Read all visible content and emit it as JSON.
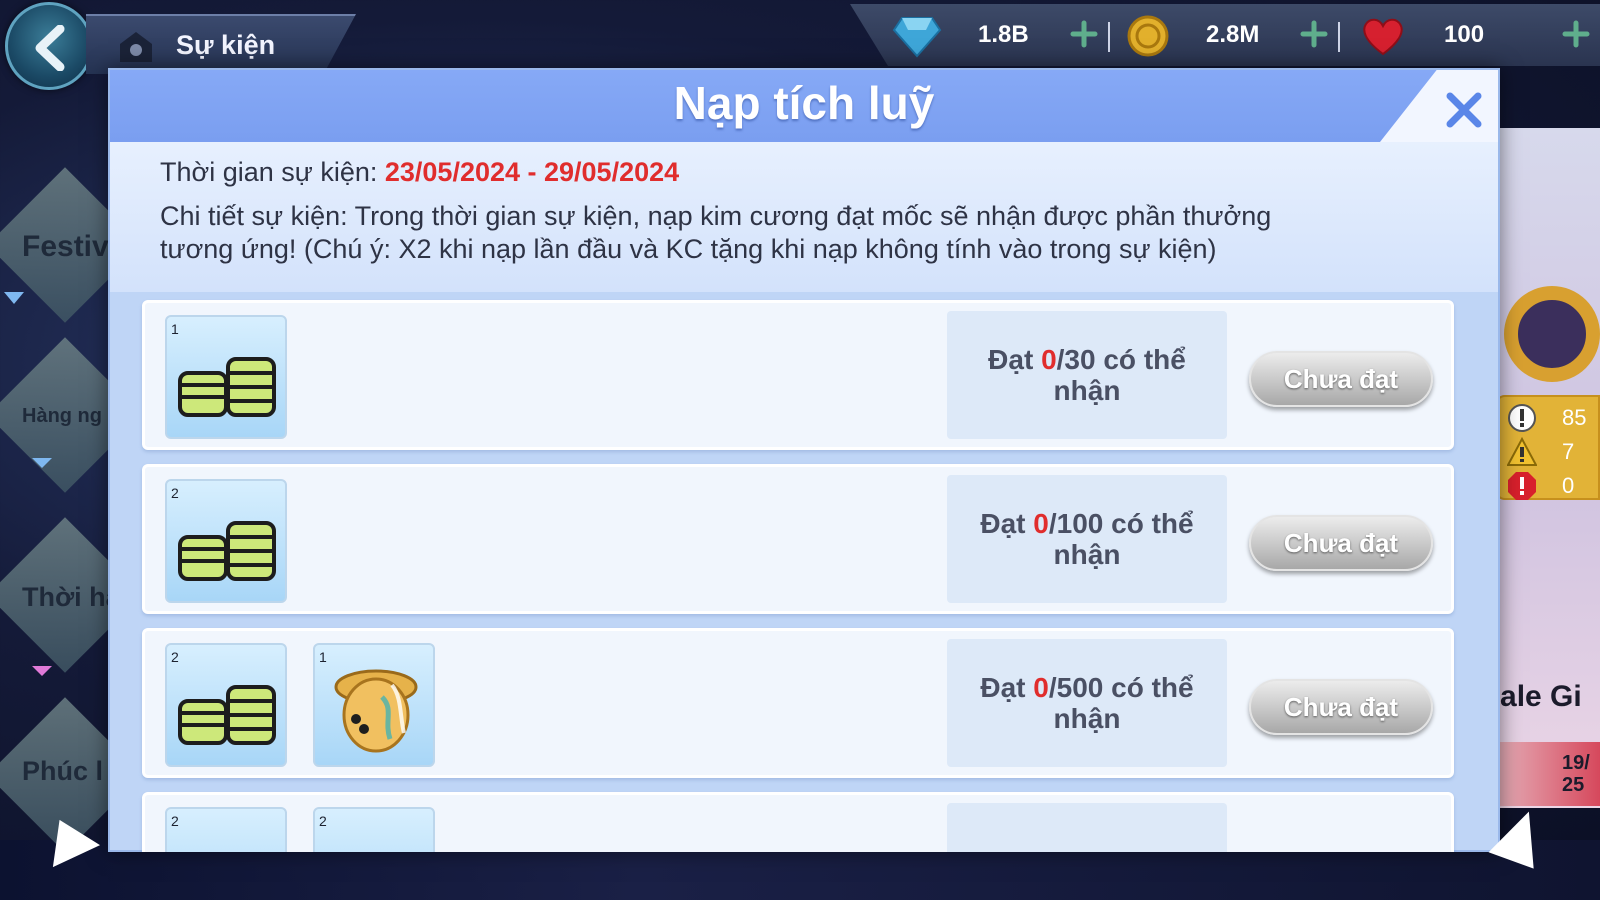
{
  "top_bar": {
    "tab_label": "Sự kiện",
    "currencies": [
      {
        "icon": "diamond-icon",
        "value": "1.8B"
      },
      {
        "icon": "gold-coin-icon",
        "value": "2.8M"
      },
      {
        "icon": "heart-icon",
        "value": "100"
      }
    ]
  },
  "side_tabs": [
    {
      "label": "Festiv"
    },
    {
      "label": "Hàng ng"
    },
    {
      "label": "Thời ha"
    },
    {
      "label": "Phúc l"
    }
  ],
  "right_panel": {
    "sale_label": "Sale Gi",
    "date_line1": "19/",
    "date_line2": "25",
    "status": [
      {
        "icon": "info-icon",
        "count": "85"
      },
      {
        "icon": "warning-icon",
        "count": "7"
      },
      {
        "icon": "error-icon",
        "count": "0"
      }
    ]
  },
  "dialog": {
    "title": "Nạp tích luỹ",
    "time_label": "Thời gian sự kiện: ",
    "time_range": "23/05/2024 - 29/05/2024",
    "detail_line1": "Chi tiết sự kiện: Trong thời gian sự kiện, nạp kim cương đạt mốc sẽ nhận được phần thưởng",
    "detail_line2": "tương ứng! (Chú ý: X2 khi nạp lần đầu và KC tặng khi nạp không tính vào trong sự kiện)",
    "rows": [
      {
        "items": [
          {
            "qty": "1",
            "icon": "coin-stack-icon"
          }
        ],
        "prefix": "Đạt ",
        "current": "0",
        "target": "/30 có thể",
        "suffix": "nhận",
        "button": "Chưa đạt"
      },
      {
        "items": [
          {
            "qty": "2",
            "icon": "coin-stack-icon"
          }
        ],
        "prefix": "Đạt ",
        "current": "0",
        "target": "/100 có thể",
        "suffix": "nhận",
        "button": "Chưa đạt"
      },
      {
        "items": [
          {
            "qty": "2",
            "icon": "coin-stack-icon"
          },
          {
            "qty": "1",
            "icon": "straw-hat-icon"
          }
        ],
        "prefix": "Đạt ",
        "current": "0",
        "target": "/500 có thể",
        "suffix": "nhận",
        "button": "Chưa đạt"
      },
      {
        "items": [
          {
            "qty": "2",
            "icon": "coin-stack-icon"
          },
          {
            "qty": "2",
            "icon": "item-icon"
          }
        ]
      }
    ]
  }
}
